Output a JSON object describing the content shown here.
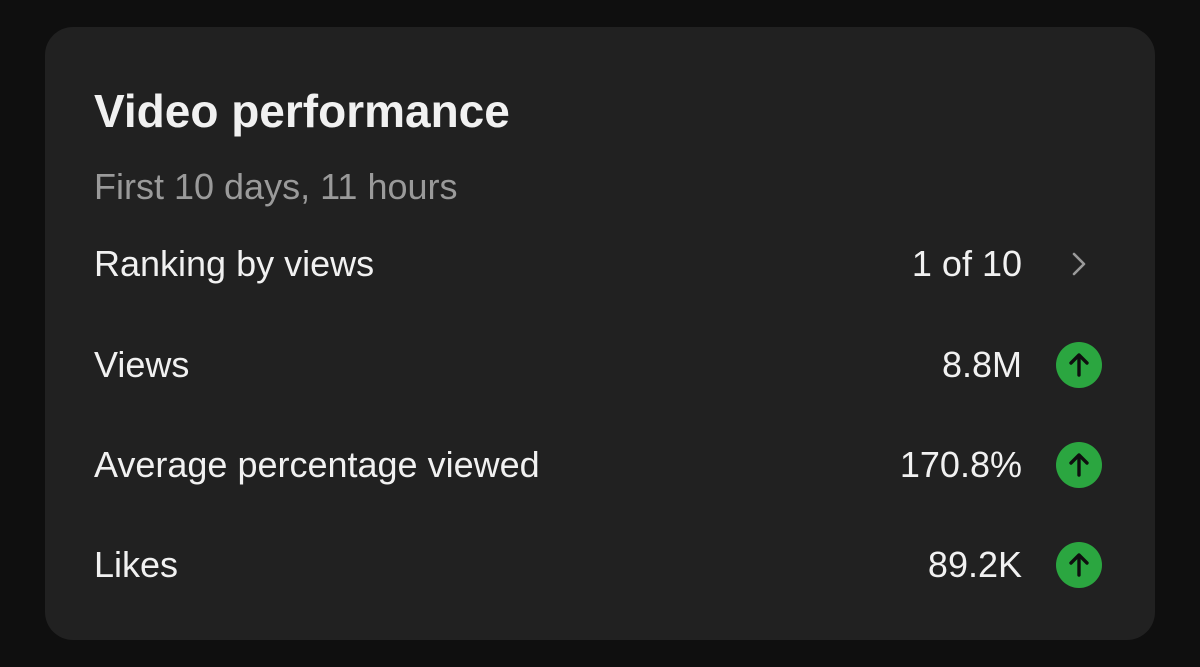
{
  "card": {
    "title": "Video performance",
    "subtitle": "First 10 days, 11 hours"
  },
  "rows": [
    {
      "label": "Ranking by views",
      "value": "1 of 10",
      "trail_icon": "chevron-right-icon"
    },
    {
      "label": "Views",
      "value": "8.8M",
      "trail_icon": "up-arrow-icon"
    },
    {
      "label": "Average percentage viewed",
      "value": "170.8%",
      "trail_icon": "up-arrow-icon"
    },
    {
      "label": "Likes",
      "value": "89.2K",
      "trail_icon": "up-arrow-icon"
    }
  ],
  "colors": {
    "background": "#0f0f0f",
    "card": "#212121",
    "text_primary": "#f1f1f1",
    "text_secondary": "#9a9a9a",
    "positive": "#2ba640"
  }
}
